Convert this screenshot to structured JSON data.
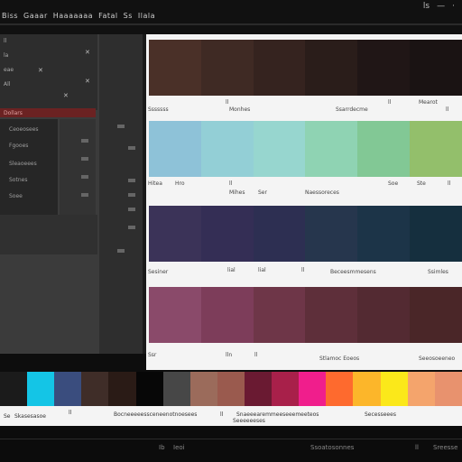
{
  "window": {
    "title": "Biss",
    "menu_items": [
      "Gaaar",
      "Haaaaaaa",
      "Fatal",
      "Ss",
      "Ilala"
    ],
    "controls": [
      "ls",
      "—",
      "·"
    ]
  },
  "left_panel": {
    "rows": [
      "ll",
      "la",
      "eae",
      "All"
    ],
    "list_items": [
      "Ceoeosees",
      "Fgooes",
      "Sleaoeees",
      "Sotnes",
      "Soee"
    ],
    "highlight_label": "Dollars"
  },
  "swatch_rows": [
    {
      "colors": [
        "#4a3028",
        "#3f2a24",
        "#35231f",
        "#2a1d1a",
        "#201616",
        "#1a1313"
      ],
      "labels": [
        "Sssssss",
        "ll",
        "Monhes",
        "Ssarrdecme",
        "ll",
        "Mearot",
        "ll"
      ]
    },
    {
      "colors": [
        "#8ec2d8",
        "#93cfd6",
        "#97d6cf",
        "#8fd3b3",
        "#82c895",
        "#93bf6b"
      ],
      "labels": [
        "Hitea",
        "Hro",
        "ll",
        "Mihes",
        "Ser",
        "Naessoreces",
        "Soe",
        "Ste",
        "ll"
      ]
    },
    {
      "colors": [
        "#3b3358",
        "#342e55",
        "#2d2f52",
        "#26364d",
        "#1c3448",
        "#152f3e"
      ],
      "labels": [
        "Sesiner",
        "lial",
        "lial",
        "ll",
        "Beceesmmesens",
        "Ssimles"
      ]
    },
    {
      "colors": [
        "#8a4a6a",
        "#7d3d5a",
        "#6e3648",
        "#5e2f3a",
        "#532a32",
        "#4a2628"
      ],
      "labels": [
        "Ssr",
        "lln",
        "ll",
        "Stlamoc Eoeos",
        "Seeosoeeneo"
      ]
    }
  ],
  "palette": {
    "colors": [
      "#1b1b1b",
      "#14c5e6",
      "#3a4d7e",
      "#3f2d28",
      "#2a1b16",
      "#070707",
      "#474747",
      "#9b6b5b",
      "#9a5a4e",
      "#6a1a32",
      "#a8204a",
      "#f01e8c",
      "#fe6a2e",
      "#fcb62a",
      "#fbe81a",
      "#f4a46c",
      "#e8926e"
    ],
    "captions": [
      "Se",
      "Skasesasoe",
      "ll",
      "Bocneeeeessceneenotnoesees",
      "ll",
      "Snaeeearemmeeseeemeeteos",
      "Secesseees"
    ],
    "sub_caption": "Seeeeeeses"
  },
  "footer": {
    "items": [
      "Ib",
      "Ieoi",
      "Ssoatosonnes",
      "ll",
      "Sreesse"
    ]
  }
}
